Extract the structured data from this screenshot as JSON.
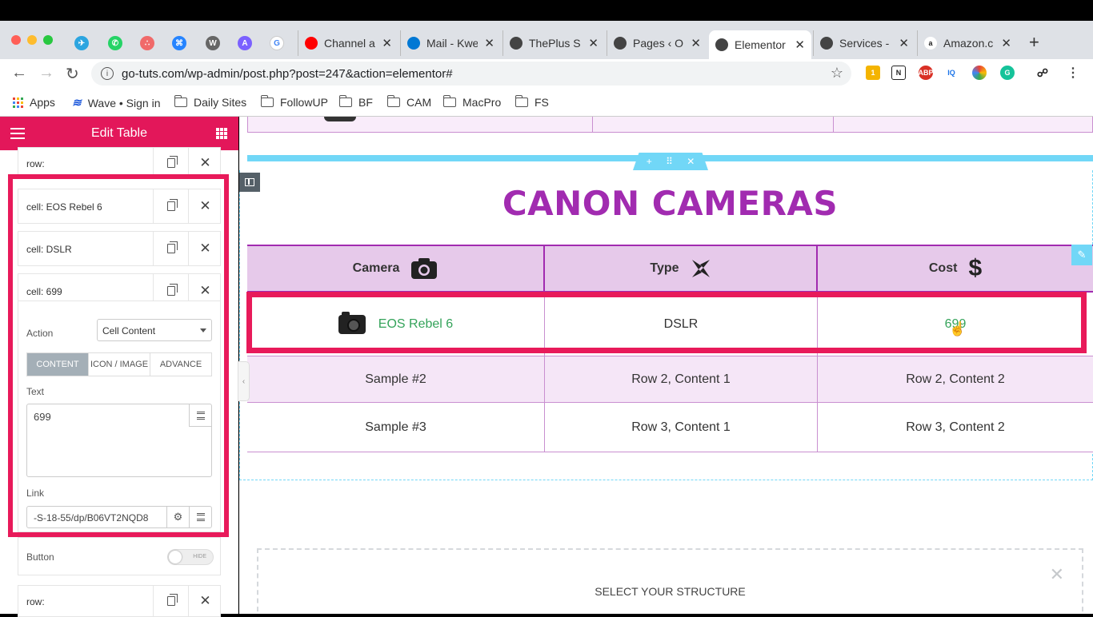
{
  "browser": {
    "pinned_tabs": [
      {
        "name": "telegram",
        "color": "#2ca5e0",
        "glyph": "✈"
      },
      {
        "name": "whatsapp",
        "color": "#25d366",
        "glyph": "✆"
      },
      {
        "name": "asana",
        "color": "#f06a6a",
        "glyph": "∴"
      },
      {
        "name": "confluence",
        "color": "#2684ff",
        "glyph": "⌘"
      },
      {
        "name": "wordpress",
        "color": "#666666",
        "glyph": "W"
      },
      {
        "name": "vectorize",
        "color": "#7b61ff",
        "glyph": "A"
      },
      {
        "name": "google",
        "color": "#ffffff",
        "glyph": "G"
      }
    ],
    "tabs": [
      {
        "title": "Channel a",
        "favicon_color": "#ff0000",
        "icon": "youtube-icon"
      },
      {
        "title": "Mail - Kwe",
        "favicon_color": "#0078d4",
        "icon": "outlook-icon"
      },
      {
        "title": "ThePlus S",
        "favicon_color": "#444444",
        "icon": "wordpress-icon"
      },
      {
        "title": "Pages ‹ O",
        "favicon_color": "#444444",
        "icon": "wordpress-icon"
      },
      {
        "title": "Elementor",
        "favicon_color": "#444444",
        "icon": "wordpress-icon",
        "active": true
      },
      {
        "title": "Services -",
        "favicon_color": "#444444",
        "icon": "wordpress-icon"
      },
      {
        "title": "Amazon.c",
        "favicon_color": "#ffffff",
        "icon": "amazon-icon"
      }
    ],
    "url": "go-tuts.com/wp-admin/post.php?post=247&action=elementor#",
    "bookmarks": [
      {
        "label": "Apps",
        "type": "apps"
      },
      {
        "label": "Wave • Sign in",
        "type": "site"
      },
      {
        "label": "Daily Sites",
        "type": "folder"
      },
      {
        "label": "FollowUP",
        "type": "folder"
      },
      {
        "label": "BF",
        "type": "folder"
      },
      {
        "label": "CAM",
        "type": "folder"
      },
      {
        "label": "MacPro",
        "type": "folder"
      },
      {
        "label": "FS",
        "type": "folder"
      }
    ]
  },
  "panel": {
    "title": "Edit Table",
    "accent": "#e3175a",
    "repeater_top": "row:",
    "cells": [
      "cell: EOS Rebel 6",
      "cell: DSLR",
      "cell: 699"
    ],
    "action_label": "Action",
    "action_value": "Cell Content",
    "tabs": [
      "CONTENT",
      "ICON / IMAGE",
      "ADVANCE"
    ],
    "text_label": "Text",
    "text_value": "699",
    "link_label": "Link",
    "link_value": "-S-18-55/dp/B06VT2NQD8",
    "button_label": "Button",
    "button_toggle": "HIDE",
    "repeater_bottom": "row:"
  },
  "canvas": {
    "heading": "CANON CAMERAS",
    "heading_color": "#a12bb0",
    "table": {
      "headers": [
        "Camera",
        "Type",
        "Cost"
      ],
      "rows": [
        [
          "EOS Rebel 6",
          "DSLR",
          "699"
        ],
        [
          "Sample #2",
          "Row 2, Content 1",
          "Row 2, Content 2"
        ],
        [
          "Sample #3",
          "Row 3, Content 1",
          "Row 3, Content 2"
        ]
      ],
      "link_color": "#34a35a"
    },
    "add_section_title": "SELECT YOUR STRUCTURE"
  }
}
